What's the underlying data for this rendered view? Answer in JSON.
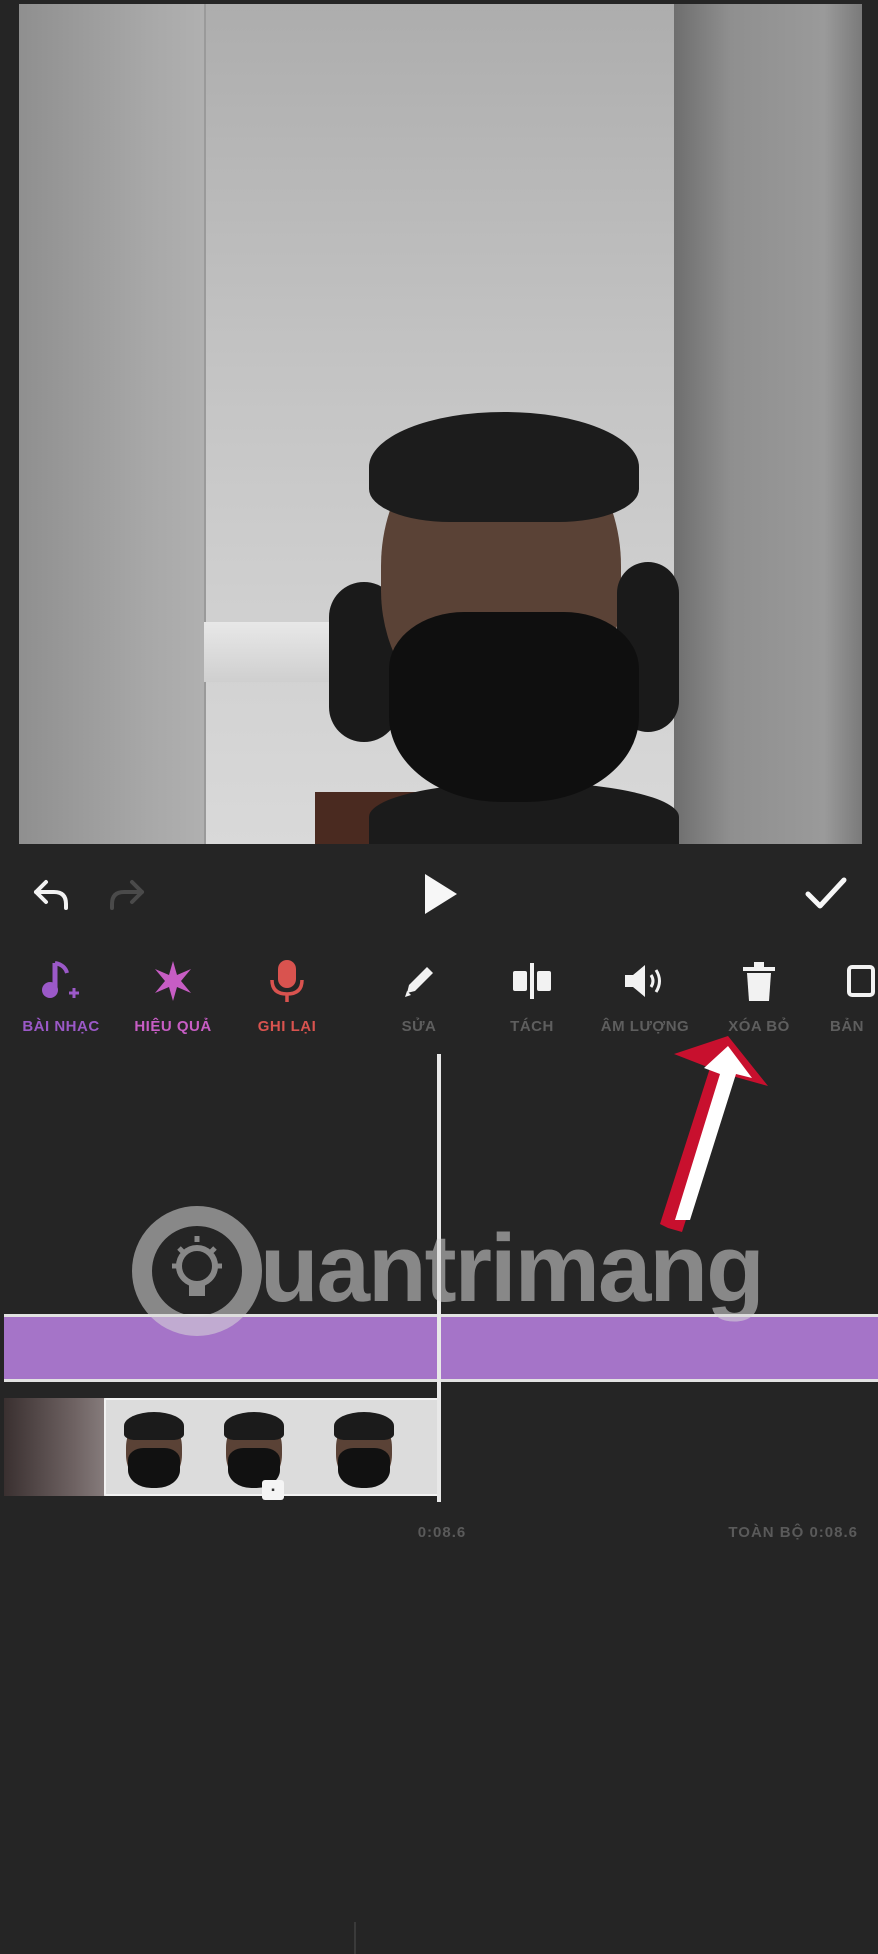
{
  "controls": {
    "undo_icon": "undo-icon",
    "redo_icon": "redo-icon",
    "play_icon": "play-icon",
    "done_icon": "check-icon"
  },
  "toolbar": {
    "items": [
      {
        "label": "BÀI NHẠC",
        "icon": "music-add-icon",
        "color": "#9b59c8"
      },
      {
        "label": "HIỆU QUẢ",
        "icon": "sparkle-icon",
        "color": "#c75dc4"
      },
      {
        "label": "GHI LẠI",
        "icon": "microphone-icon",
        "color": "#d9534f"
      },
      {
        "label": "SỬA",
        "icon": "pencil-icon",
        "color": "#5e5e5e"
      },
      {
        "label": "TÁCH",
        "icon": "split-icon",
        "color": "#5e5e5e"
      },
      {
        "label": "ÂM LƯỢNG",
        "icon": "volume-icon",
        "color": "#5e5e5e"
      },
      {
        "label": "XÓA BỎ",
        "icon": "trash-icon",
        "color": "#5e5e5e"
      },
      {
        "label": "BẢN",
        "icon": "copy-icon",
        "color": "#5e5e5e"
      }
    ]
  },
  "timeline": {
    "current_time": "0:08.6",
    "total_time": "TOÀN BỘ 0:08.6",
    "audio_track_color": "#a574c8"
  },
  "watermark": {
    "text": "uantrimang"
  },
  "colors": {
    "background": "#252525",
    "annotation_arrow": "#c8102e"
  }
}
